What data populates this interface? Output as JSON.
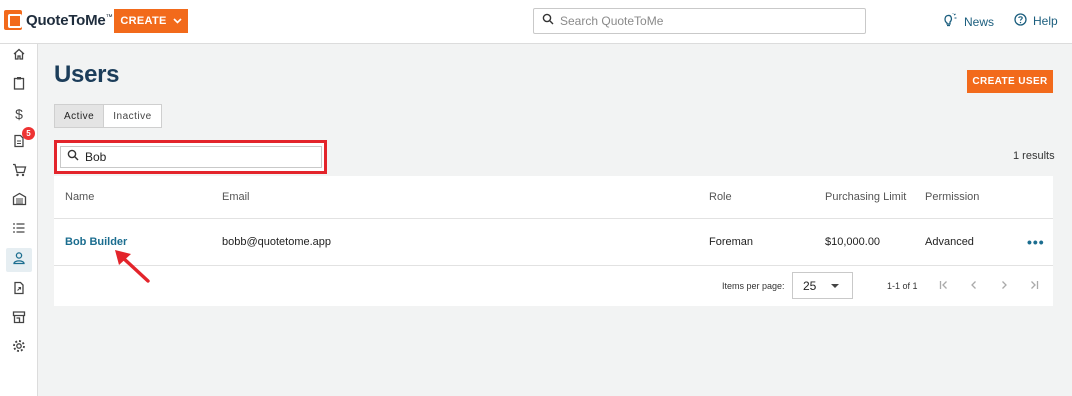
{
  "app": {
    "name": "QuoteToMe",
    "tm": "™"
  },
  "topbar": {
    "create_label": "CREATE",
    "search_placeholder": "Search QuoteToMe",
    "news_label": "News",
    "help_label": "Help"
  },
  "sidebar": {
    "items": [
      {
        "icon": "home-icon"
      },
      {
        "icon": "clipboard-icon"
      },
      {
        "icon": "dollar-icon"
      },
      {
        "icon": "document-icon",
        "badge": "5"
      },
      {
        "icon": "cart-icon"
      },
      {
        "icon": "warehouse-icon"
      },
      {
        "icon": "list-icon"
      },
      {
        "icon": "user-icon",
        "active": true
      },
      {
        "icon": "file-export-icon"
      },
      {
        "icon": "store-icon"
      },
      {
        "icon": "gear-icon"
      }
    ]
  },
  "page": {
    "title": "Users",
    "create_user_label": "CREATE USER",
    "filter_tabs": {
      "active": "Active",
      "inactive": "Inactive"
    },
    "search_value": "Bob",
    "results_text": "1 results"
  },
  "table": {
    "headers": {
      "name": "Name",
      "email": "Email",
      "role": "Role",
      "limit": "Purchasing Limit",
      "permission": "Permission"
    },
    "rows": [
      {
        "name": "Bob Builder",
        "email": "bobb@quotetome.app",
        "role": "Foreman",
        "limit": "$10,000.00",
        "permission": "Advanced",
        "more": "•••"
      }
    ]
  },
  "pagination": {
    "items_per_page_label": "Items per page:",
    "items_per_page": "25",
    "range": "1-1 of 1"
  },
  "colors": {
    "accent": "#f26a1b",
    "link": "#1b6d8f",
    "title": "#1c3d5a",
    "highlight": "#e3242b"
  }
}
